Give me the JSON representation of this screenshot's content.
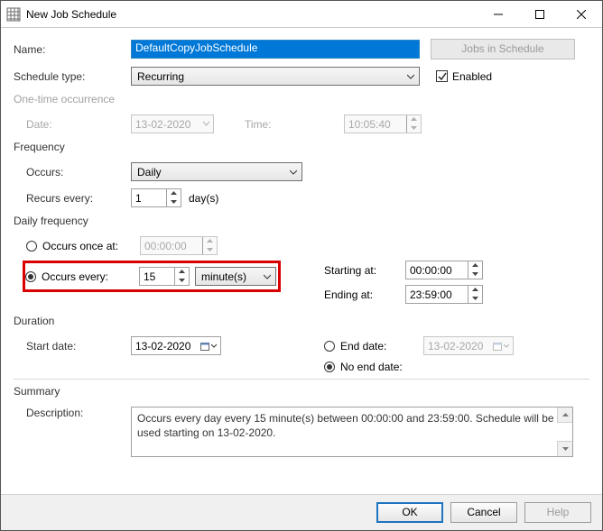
{
  "window": {
    "title": "New Job Schedule"
  },
  "form": {
    "name_label": "Name:",
    "name_value": "DefaultCopyJobSchedule",
    "jobs_in_schedule": "Jobs in Schedule",
    "schedule_type_label": "Schedule type:",
    "schedule_type_value": "Recurring",
    "enabled_label": "Enabled"
  },
  "one_time": {
    "legend": "One-time occurrence",
    "date_label": "Date:",
    "date_value": "13-02-2020",
    "time_label": "Time:",
    "time_value": "10:05:40"
  },
  "frequency": {
    "legend": "Frequency",
    "occurs_label": "Occurs:",
    "occurs_value": "Daily",
    "recurs_label": "Recurs every:",
    "recurs_value": "1",
    "recurs_unit": "day(s)"
  },
  "daily_freq": {
    "legend": "Daily frequency",
    "once_label": "Occurs once at:",
    "once_value": "00:00:00",
    "every_label": "Occurs every:",
    "every_value": "15",
    "every_unit": "minute(s)",
    "starting_label": "Starting at:",
    "starting_value": "00:00:00",
    "ending_label": "Ending at:",
    "ending_value": "23:59:00"
  },
  "duration": {
    "legend": "Duration",
    "start_label": "Start date:",
    "start_value": "13-02-2020",
    "end_label": "End date:",
    "end_value": "13-02-2020",
    "noend_label": "No end date:"
  },
  "summary": {
    "legend": "Summary",
    "desc_label": "Description:",
    "desc_value": "Occurs every day every 15 minute(s) between 00:00:00 and 23:59:00. Schedule will be used starting on 13-02-2020."
  },
  "buttons": {
    "ok": "OK",
    "cancel": "Cancel",
    "help": "Help"
  }
}
